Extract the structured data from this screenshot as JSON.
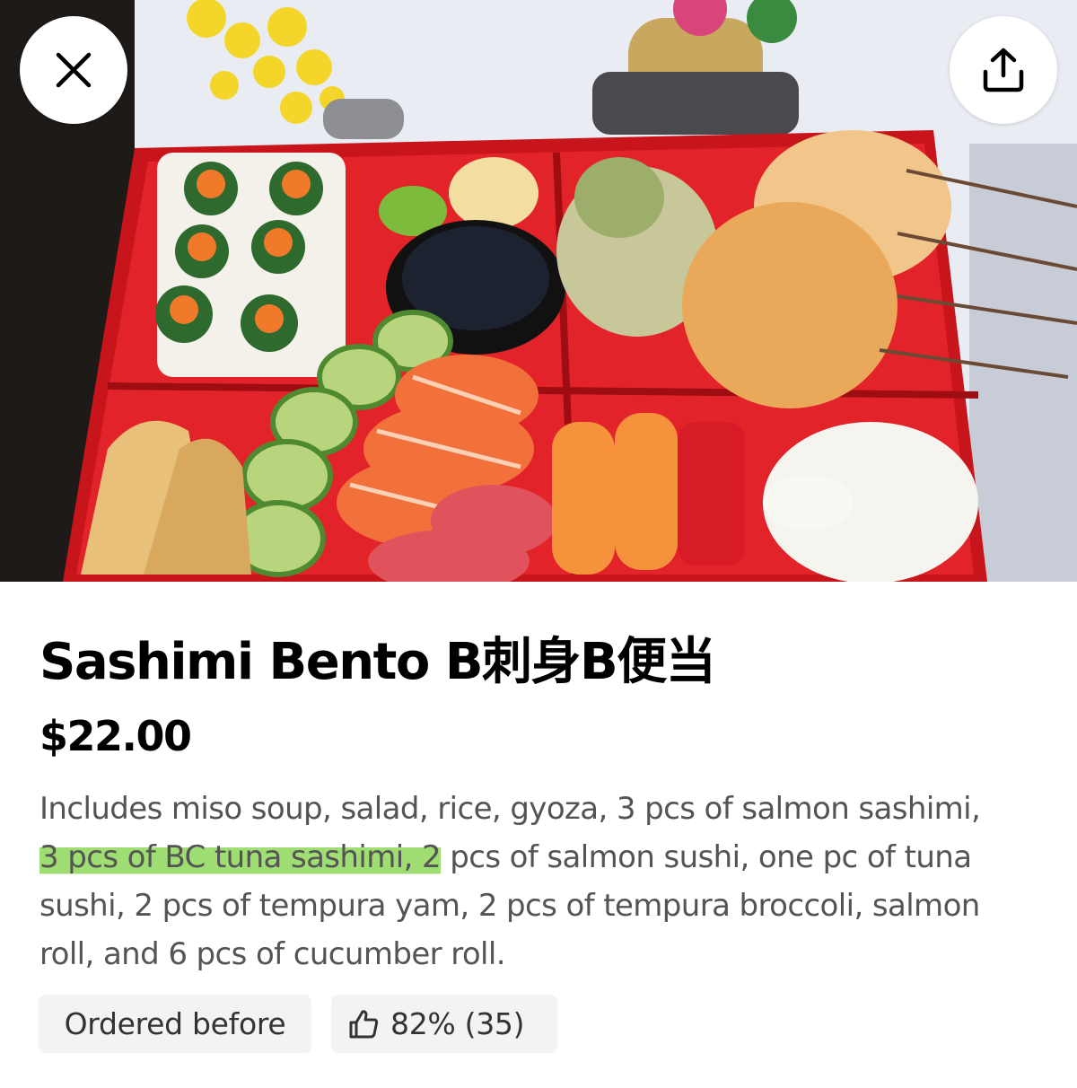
{
  "item": {
    "title": "Sashimi Bento B刺身B便当",
    "price": "$22.00",
    "description": {
      "line1": "Includes miso soup, salad, rice, gyoza, 3 pcs of salmon sashimi,",
      "line2_highlight": "3 pcs of BC tuna sashimi, 2",
      "line2_rest": " pcs of salmon sushi, one pc of tuna",
      "line3": "sushi, 2 pcs of tempura yam, 2 pcs of tempura broccoli, salmon",
      "line4": "roll, and 6 pcs of cucumber roll."
    }
  },
  "badges": {
    "ordered_before": "Ordered before",
    "rating": "82% (35)"
  },
  "header": {
    "close_icon": "close-icon",
    "share_icon": "share-icon"
  },
  "colors": {
    "highlight": "#8ad654",
    "chip_bg": "#f3f3f3",
    "text_secondary": "#545454"
  }
}
